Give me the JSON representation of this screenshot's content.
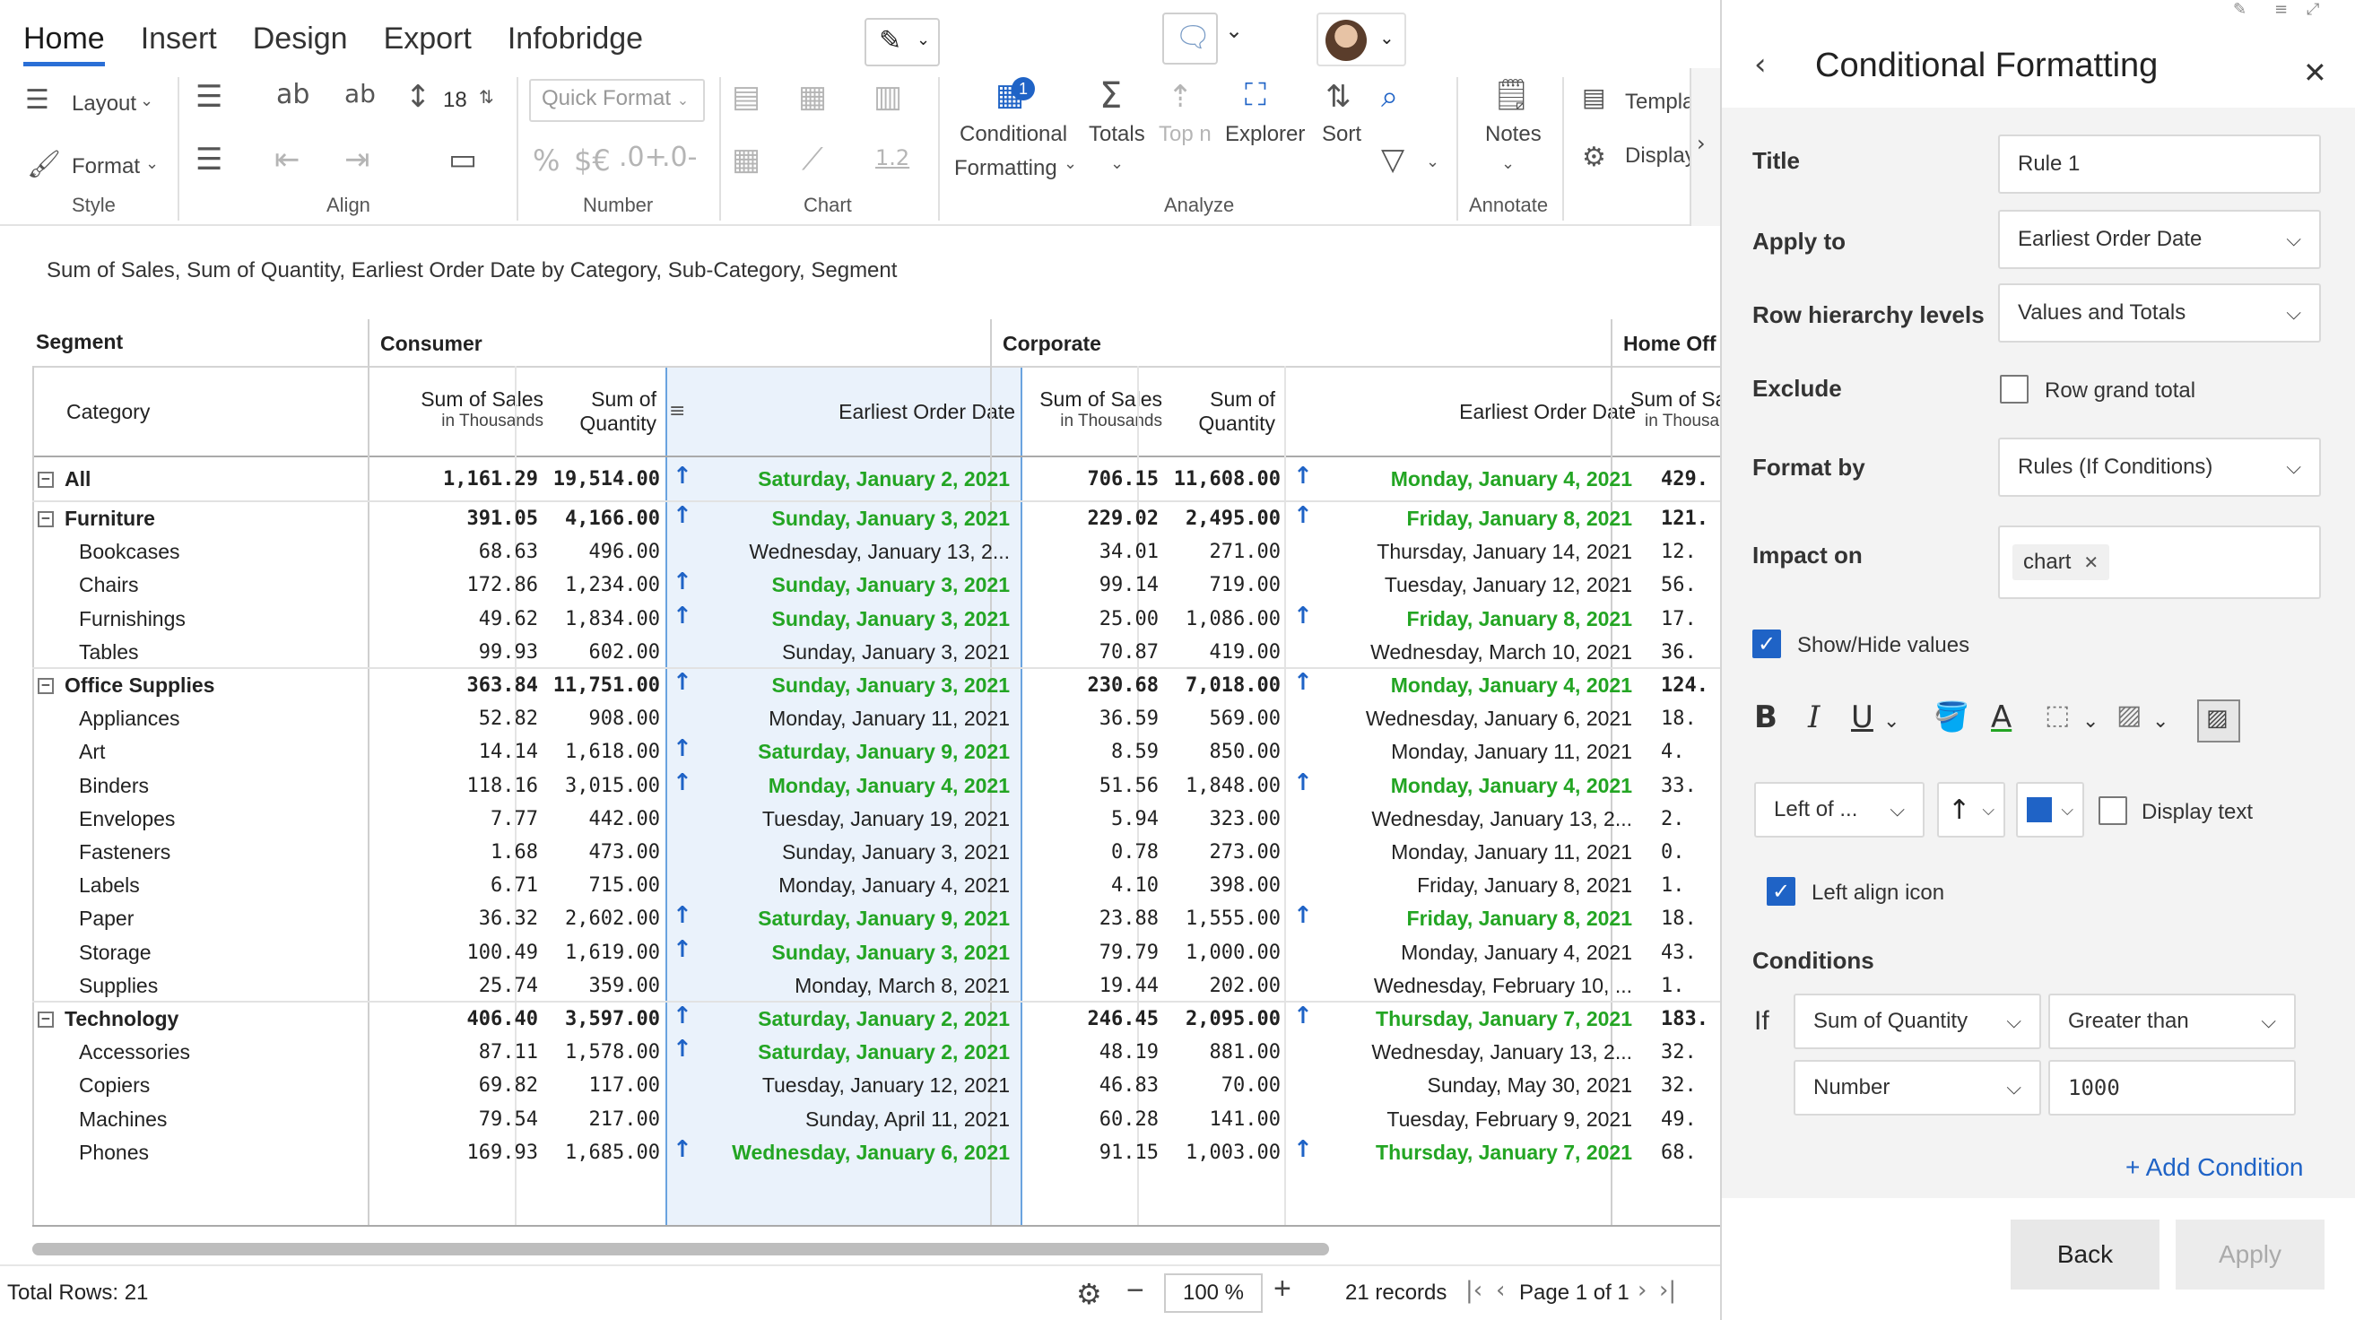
{
  "ribbon": {
    "tabs": [
      "Home",
      "Insert",
      "Design",
      "Export",
      "Infobridge"
    ],
    "style": {
      "layout": "Layout",
      "format": "Format",
      "group": "Style"
    },
    "align": {
      "group": "Align"
    },
    "font_size": "18",
    "number": {
      "quick_format": "Quick Format",
      "percent": "%",
      "currency": "$€",
      "inc": ".0+",
      "dec": ".0-",
      "group": "Number"
    },
    "chart": {
      "group": "Chart",
      "value": "1.2"
    },
    "analyze": {
      "conditional": "Conditional",
      "formatting": "Formatting",
      "badge": "1",
      "totals": "Totals",
      "topn": "Top n",
      "explorer": "Explorer",
      "sort": "Sort",
      "group": "Analyze"
    },
    "annotate": {
      "notes": "Notes",
      "group": "Annotate"
    },
    "extra": {
      "template": "Templa",
      "display": "Display"
    }
  },
  "subtitle": "Sum of Sales, Sum of Quantity, Earliest Order Date by Category, Sub-Category, Segment",
  "table": {
    "segment_label": "Segment",
    "category_label": "Category",
    "segments": [
      "Consumer",
      "Corporate",
      "Home Off"
    ],
    "col_headers": {
      "sales": "Sum of Sales",
      "sales_sub": "in Thousands",
      "qty1": "Sum of",
      "qty2": "Quantity",
      "date": "Earliest Order Date",
      "sales_cut": "Sum of Sa",
      "sales_sub_cut": "in Thousa"
    },
    "rows": [
      {
        "label": "All",
        "level": 0,
        "exp": "−",
        "c_sales": "1,161.29",
        "c_qty": "19,514.00",
        "c_date": "Saturday, January 2, 2021",
        "c_hl": true,
        "p_sales": "706.15",
        "p_qty": "11,608.00",
        "p_date": "Monday, January 4, 2021",
        "p_hl": true,
        "h_sales": "429."
      },
      {
        "label": "Furniture",
        "level": 0,
        "exp": "−",
        "c_sales": "391.05",
        "c_qty": "4,166.00",
        "c_date": "Sunday, January 3, 2021",
        "c_hl": true,
        "p_sales": "229.02",
        "p_qty": "2,495.00",
        "p_date": "Friday, January 8, 2021",
        "p_hl": true,
        "h_sales": "121."
      },
      {
        "label": "Bookcases",
        "level": 1,
        "c_sales": "68.63",
        "c_qty": "496.00",
        "c_date": "Wednesday, January 13, 2...",
        "c_hl": false,
        "p_sales": "34.01",
        "p_qty": "271.00",
        "p_date": "Thursday, January 14, 2021",
        "p_hl": false,
        "h_sales": "12."
      },
      {
        "label": "Chairs",
        "level": 1,
        "c_sales": "172.86",
        "c_qty": "1,234.00",
        "c_date": "Sunday, January 3, 2021",
        "c_hl": true,
        "p_sales": "99.14",
        "p_qty": "719.00",
        "p_date": "Tuesday, January 12, 2021",
        "p_hl": false,
        "h_sales": "56."
      },
      {
        "label": "Furnishings",
        "level": 1,
        "c_sales": "49.62",
        "c_qty": "1,834.00",
        "c_date": "Sunday, January 3, 2021",
        "c_hl": true,
        "p_sales": "25.00",
        "p_qty": "1,086.00",
        "p_date": "Friday, January 8, 2021",
        "p_hl": true,
        "h_sales": "17."
      },
      {
        "label": "Tables",
        "level": 1,
        "c_sales": "99.93",
        "c_qty": "602.00",
        "c_date": "Sunday, January 3, 2021",
        "c_hl": false,
        "p_sales": "70.87",
        "p_qty": "419.00",
        "p_date": "Wednesday, March 10, 2021",
        "p_hl": false,
        "h_sales": "36."
      },
      {
        "label": "Office Supplies",
        "level": 0,
        "exp": "−",
        "c_sales": "363.84",
        "c_qty": "11,751.00",
        "c_date": "Sunday, January 3, 2021",
        "c_hl": true,
        "p_sales": "230.68",
        "p_qty": "7,018.00",
        "p_date": "Monday, January 4, 2021",
        "p_hl": true,
        "h_sales": "124."
      },
      {
        "label": "Appliances",
        "level": 1,
        "c_sales": "52.82",
        "c_qty": "908.00",
        "c_date": "Monday, January 11, 2021",
        "c_hl": false,
        "p_sales": "36.59",
        "p_qty": "569.00",
        "p_date": "Wednesday, January 6, 2021",
        "p_hl": false,
        "h_sales": "18."
      },
      {
        "label": "Art",
        "level": 1,
        "c_sales": "14.14",
        "c_qty": "1,618.00",
        "c_date": "Saturday, January 9, 2021",
        "c_hl": true,
        "p_sales": "8.59",
        "p_qty": "850.00",
        "p_date": "Monday, January 11, 2021",
        "p_hl": false,
        "h_sales": "4."
      },
      {
        "label": "Binders",
        "level": 1,
        "c_sales": "118.16",
        "c_qty": "3,015.00",
        "c_date": "Monday, January 4, 2021",
        "c_hl": true,
        "p_sales": "51.56",
        "p_qty": "1,848.00",
        "p_date": "Monday, January 4, 2021",
        "p_hl": true,
        "h_sales": "33."
      },
      {
        "label": "Envelopes",
        "level": 1,
        "c_sales": "7.77",
        "c_qty": "442.00",
        "c_date": "Tuesday, January 19, 2021",
        "c_hl": false,
        "p_sales": "5.94",
        "p_qty": "323.00",
        "p_date": "Wednesday, January 13, 2...",
        "p_hl": false,
        "h_sales": "2."
      },
      {
        "label": "Fasteners",
        "level": 1,
        "c_sales": "1.68",
        "c_qty": "473.00",
        "c_date": "Sunday, January 3, 2021",
        "c_hl": false,
        "p_sales": "0.78",
        "p_qty": "273.00",
        "p_date": "Monday, January 11, 2021",
        "p_hl": false,
        "h_sales": "0."
      },
      {
        "label": "Labels",
        "level": 1,
        "c_sales": "6.71",
        "c_qty": "715.00",
        "c_date": "Monday, January 4, 2021",
        "c_hl": false,
        "p_sales": "4.10",
        "p_qty": "398.00",
        "p_date": "Friday, January 8, 2021",
        "p_hl": false,
        "h_sales": "1."
      },
      {
        "label": "Paper",
        "level": 1,
        "c_sales": "36.32",
        "c_qty": "2,602.00",
        "c_date": "Saturday, January 9, 2021",
        "c_hl": true,
        "p_sales": "23.88",
        "p_qty": "1,555.00",
        "p_date": "Friday, January 8, 2021",
        "p_hl": true,
        "h_sales": "18."
      },
      {
        "label": "Storage",
        "level": 1,
        "c_sales": "100.49",
        "c_qty": "1,619.00",
        "c_date": "Sunday, January 3, 2021",
        "c_hl": true,
        "p_sales": "79.79",
        "p_qty": "1,000.00",
        "p_date": "Monday, January 4, 2021",
        "p_hl": false,
        "h_sales": "43."
      },
      {
        "label": "Supplies",
        "level": 1,
        "c_sales": "25.74",
        "c_qty": "359.00",
        "c_date": "Monday, March 8, 2021",
        "c_hl": false,
        "p_sales": "19.44",
        "p_qty": "202.00",
        "p_date": "Wednesday, February 10, ...",
        "p_hl": false,
        "h_sales": "1."
      },
      {
        "label": "Technology",
        "level": 0,
        "exp": "−",
        "c_sales": "406.40",
        "c_qty": "3,597.00",
        "c_date": "Saturday, January 2, 2021",
        "c_hl": true,
        "p_sales": "246.45",
        "p_qty": "2,095.00",
        "p_date": "Thursday, January 7, 2021",
        "p_hl": true,
        "h_sales": "183."
      },
      {
        "label": "Accessories",
        "level": 1,
        "c_sales": "87.11",
        "c_qty": "1,578.00",
        "c_date": "Saturday, January 2, 2021",
        "c_hl": true,
        "p_sales": "48.19",
        "p_qty": "881.00",
        "p_date": "Wednesday, January 13, 2...",
        "p_hl": false,
        "h_sales": "32."
      },
      {
        "label": "Copiers",
        "level": 1,
        "c_sales": "69.82",
        "c_qty": "117.00",
        "c_date": "Tuesday, January 12, 2021",
        "c_hl": false,
        "p_sales": "46.83",
        "p_qty": "70.00",
        "p_date": "Sunday, May 30, 2021",
        "p_hl": false,
        "h_sales": "32."
      },
      {
        "label": "Machines",
        "level": 1,
        "c_sales": "79.54",
        "c_qty": "217.00",
        "c_date": "Sunday, April 11, 2021",
        "c_hl": false,
        "p_sales": "60.28",
        "p_qty": "141.00",
        "p_date": "Tuesday, February 9, 2021",
        "p_hl": false,
        "h_sales": "49."
      },
      {
        "label": "Phones",
        "level": 1,
        "c_sales": "169.93",
        "c_qty": "1,685.00",
        "c_date": "Wednesday, January 6, 2021",
        "c_hl": true,
        "p_sales": "91.15",
        "p_qty": "1,003.00",
        "p_date": "Thursday, January 7, 2021",
        "p_hl": true,
        "h_sales": "68."
      }
    ]
  },
  "footer": {
    "total_rows": "Total Rows: 21",
    "zoom": "100 %",
    "records": "21 records",
    "page": "Page 1 of 1"
  },
  "panel": {
    "title": "Conditional Formatting",
    "title_label": "Title",
    "title_value": "Rule 1",
    "apply_label": "Apply to",
    "apply_value": "Earliest Order Date",
    "row_levels_label": "Row hierarchy levels",
    "row_levels_value": "Values and Totals",
    "exclude_label": "Exclude",
    "exclude_option": "Row grand total",
    "format_by_label": "Format by",
    "format_by_value": "Rules (If Conditions)",
    "impact_label": "Impact on",
    "impact_chip": "chart",
    "show_hide": "Show/Hide values",
    "position_value": "Left of ...",
    "display_text": "Display text",
    "left_align": "Left align icon",
    "conditions_label": "Conditions",
    "if_label": "If",
    "cond_field": "Sum of Quantity",
    "cond_op": "Greater than",
    "cond_type": "Number",
    "cond_value": "1000",
    "add_condition": "+ Add Condition",
    "back": "Back",
    "apply": "Apply",
    "icon_color": "#1f63c6"
  },
  "colors": {
    "accent": "#1f63c6",
    "highlight_green": "#23a523",
    "selected_col": "#eaf2fb"
  }
}
